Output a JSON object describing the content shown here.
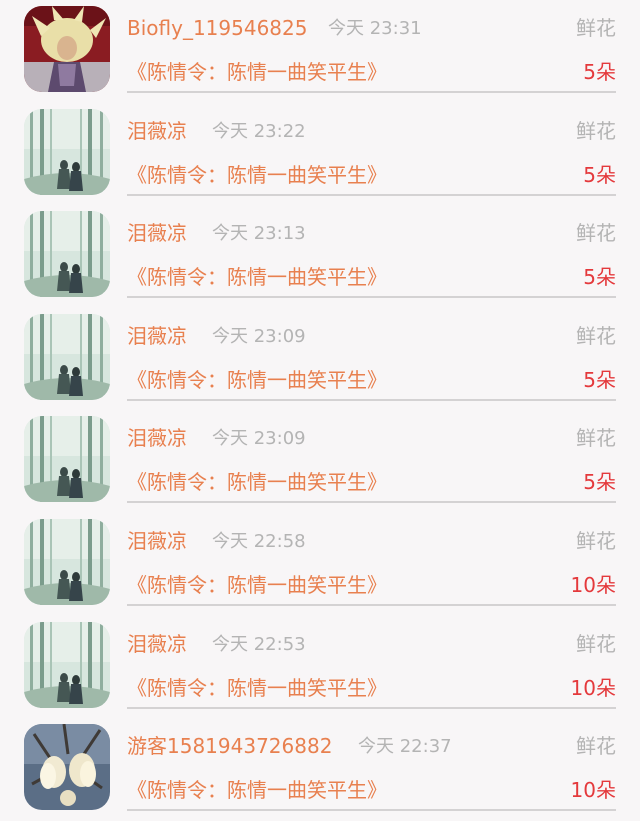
{
  "rows": [
    {
      "name": "Biofly_119546825",
      "time": "今天 23:31",
      "gift_type": "鲜花",
      "book": "《陈情令：陈情一曲笑平生》",
      "amount": "5朵",
      "avatar": "anime-warrior-avatar"
    },
    {
      "name": "泪薇凉",
      "time": "今天 23:22",
      "gift_type": "鲜花",
      "book": "《陈情令：陈情一曲笑平生》",
      "amount": "5朵",
      "avatar": "bamboo-forest-avatar"
    },
    {
      "name": "泪薇凉",
      "time": "今天 23:13",
      "gift_type": "鲜花",
      "book": "《陈情令：陈情一曲笑平生》",
      "amount": "5朵",
      "avatar": "bamboo-forest-avatar"
    },
    {
      "name": "泪薇凉",
      "time": "今天 23:09",
      "gift_type": "鲜花",
      "book": "《陈情令：陈情一曲笑平生》",
      "amount": "5朵",
      "avatar": "bamboo-forest-avatar"
    },
    {
      "name": "泪薇凉",
      "time": "今天 23:09",
      "gift_type": "鲜花",
      "book": "《陈情令：陈情一曲笑平生》",
      "amount": "5朵",
      "avatar": "bamboo-forest-avatar"
    },
    {
      "name": "泪薇凉",
      "time": "今天 22:58",
      "gift_type": "鲜花",
      "book": "《陈情令：陈情一曲笑平生》",
      "amount": "10朵",
      "avatar": "bamboo-forest-avatar"
    },
    {
      "name": "泪薇凉",
      "time": "今天 22:53",
      "gift_type": "鲜花",
      "book": "《陈情令：陈情一曲笑平生》",
      "amount": "10朵",
      "avatar": "bamboo-forest-avatar"
    },
    {
      "name": "游客1581943726882",
      "time": "今天 22:37",
      "gift_type": "鲜花",
      "book": "《陈情令：陈情一曲笑平生》",
      "amount": "10朵",
      "avatar": "magnolia-flower-avatar"
    }
  ],
  "colors": {
    "accent": "#e8804f",
    "amount": "#e4393c",
    "muted": "#b4b4b4",
    "background": "#f8f6f7"
  }
}
